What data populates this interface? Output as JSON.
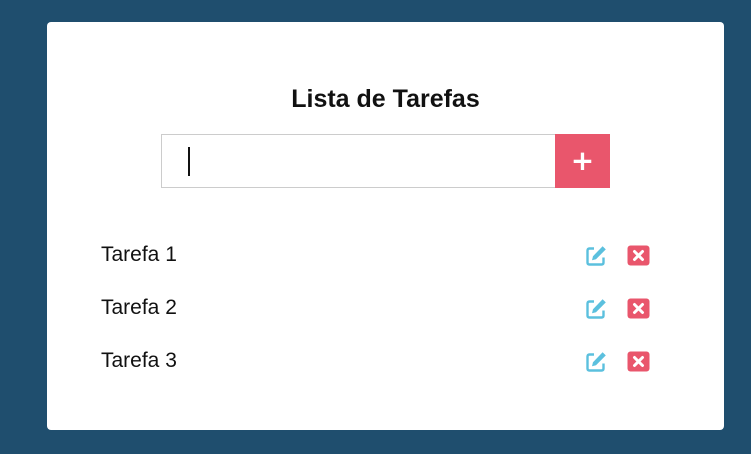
{
  "page": {
    "title": "Lista de Tarefas"
  },
  "new_task": {
    "value": "",
    "add_label": "+"
  },
  "tasks": [
    {
      "label": "Tarefa 1"
    },
    {
      "label": "Tarefa 2"
    },
    {
      "label": "Tarefa 3"
    }
  ],
  "icons": {
    "edit": "edit-icon",
    "delete": "close-icon"
  },
  "colors": {
    "background": "#1f4e6e",
    "card": "#ffffff",
    "accent": "#e9566c",
    "edit": "#5bc0de",
    "text": "#111111"
  }
}
